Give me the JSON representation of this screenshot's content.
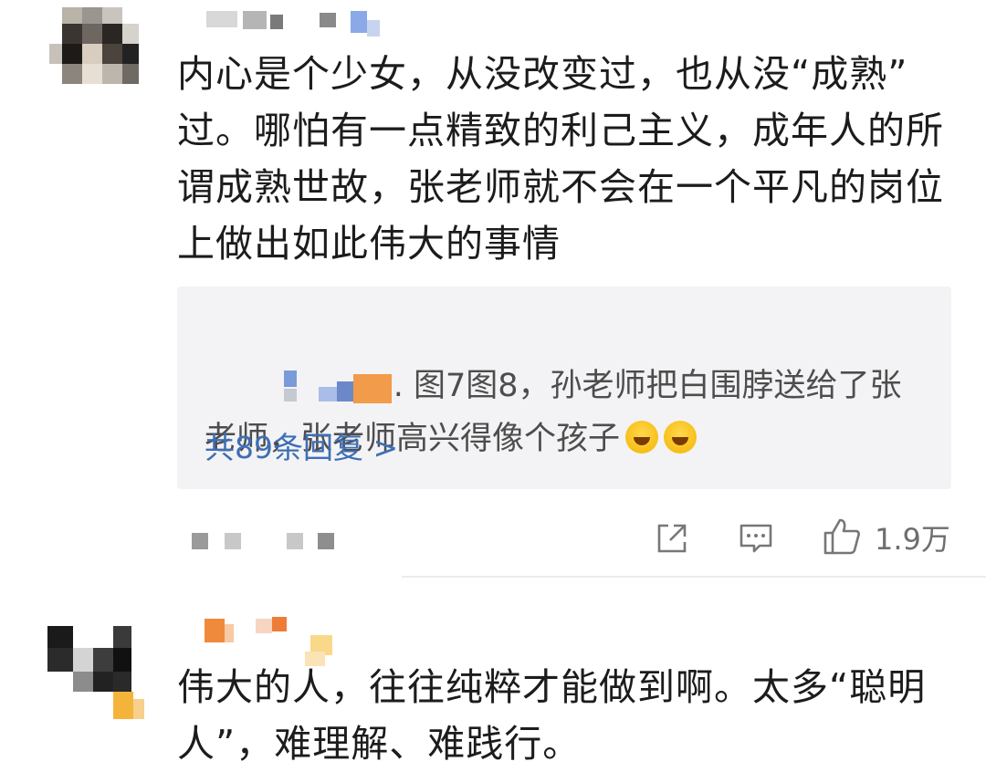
{
  "comments": [
    {
      "text": "内心是个少女，从没改变过，也从没“成熟”\n过。哪怕有一点精致的利己主义，成年人的所\n谓成熟世故，张老师就不会在一个平凡的岗位\n上做出如此伟大的事情",
      "reply": {
        "text": ". 图7图8，孙老师把白围脖送给了张\n老师，张老师高兴得像个孩子",
        "count_label": "共89条回复 >"
      },
      "likes": "1.9万",
      "icons": [
        "share-icon",
        "comment-icon",
        "like-icon"
      ]
    },
    {
      "text": "伟大的人，往往纯粹才能做到啊。太多“聪明\n人”，难理解、难践行。"
    }
  ],
  "colors": {
    "link": "#3e6fb5",
    "reply_bg": "#f3f3f5",
    "icon": "#777777"
  }
}
